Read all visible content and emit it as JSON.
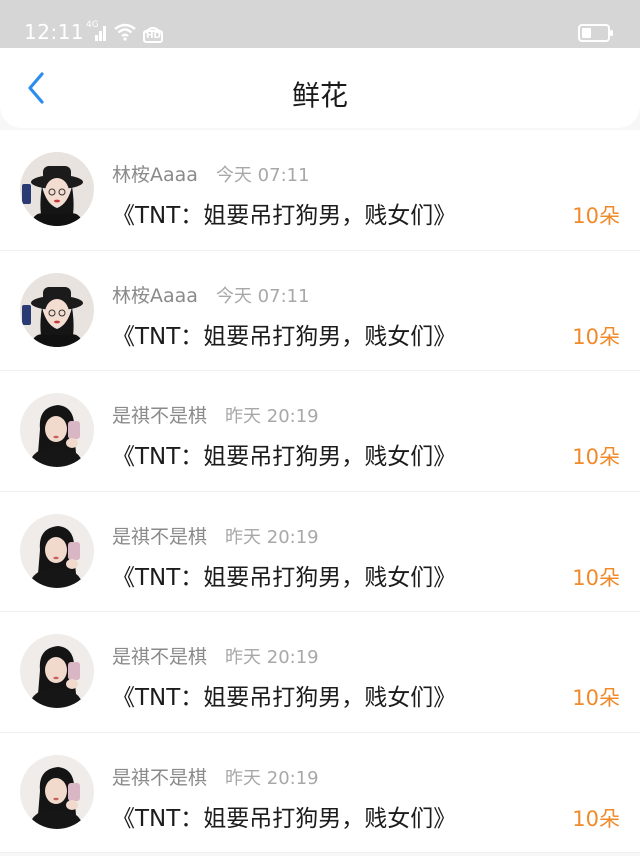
{
  "status_bar": {
    "time": "12:11",
    "network": "4G",
    "hd": "HD",
    "icons": [
      "signal-icon",
      "wifi-icon",
      "hd-icon",
      "battery-icon"
    ]
  },
  "header": {
    "title": "鲜花",
    "back_icon": "chevron-left-icon"
  },
  "colors": {
    "accent_blue": "#2d8cf0",
    "count_orange": "#f08a2a"
  },
  "items": [
    {
      "name": "林桉Aaaa",
      "time": "今天 07:11",
      "message": "《TNT：姐要吊打狗男，贱女们》",
      "count": "10朵",
      "avatar": "avatar-girl-hat"
    },
    {
      "name": "林桉Aaaa",
      "time": "今天 07:11",
      "message": "《TNT：姐要吊打狗男，贱女们》",
      "count": "10朵",
      "avatar": "avatar-girl-hat"
    },
    {
      "name": "是祺不是棋",
      "time": "昨天 20:19",
      "message": "《TNT：姐要吊打狗男，贱女们》",
      "count": "10朵",
      "avatar": "avatar-girl-mirror"
    },
    {
      "name": "是祺不是棋",
      "time": "昨天 20:19",
      "message": "《TNT：姐要吊打狗男，贱女们》",
      "count": "10朵",
      "avatar": "avatar-girl-mirror"
    },
    {
      "name": "是祺不是棋",
      "time": "昨天 20:19",
      "message": "《TNT：姐要吊打狗男，贱女们》",
      "count": "10朵",
      "avatar": "avatar-girl-mirror"
    },
    {
      "name": "是祺不是棋",
      "time": "昨天 20:19",
      "message": "《TNT：姐要吊打狗男，贱女们》",
      "count": "10朵",
      "avatar": "avatar-girl-mirror"
    }
  ]
}
